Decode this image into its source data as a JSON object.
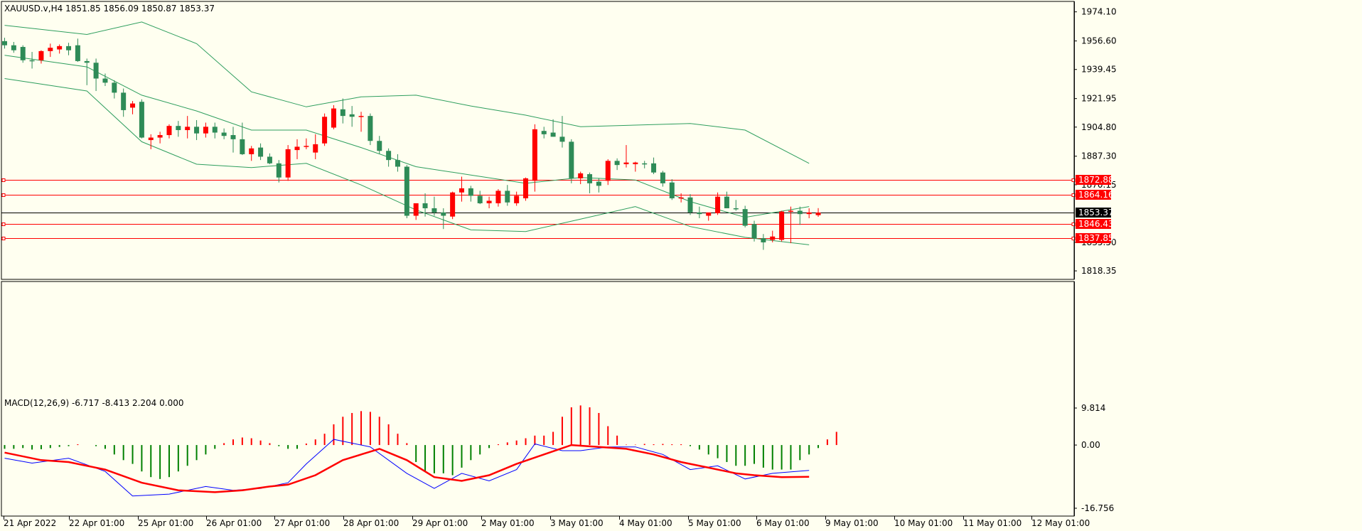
{
  "chart_data": [
    {
      "type": "candlestick",
      "title": "XAUUSD.v,H4  1851.85 1856.09 1850.87 1853.37",
      "symbol": "XAUUSD.v",
      "timeframe": "H4",
      "ohlc_last": {
        "open": 1851.85,
        "high": 1856.09,
        "low": 1850.87,
        "close": 1853.37
      },
      "ylim": [
        1811.0,
        1980.0
      ],
      "y_ticks": [
        "1974.10",
        "1956.60",
        "1939.45",
        "1921.95",
        "1904.80",
        "1887.30",
        "1870.15",
        "1835.50",
        "1818.35"
      ],
      "x_ticks": [
        "21 Apr 2022",
        "22 Apr 01:00",
        "25 Apr 01:00",
        "26 Apr 01:00",
        "27 Apr 01:00",
        "28 Apr 01:00",
        "29 Apr 01:00",
        "2 May 01:00",
        "3 May 01:00",
        "4 May 01:00",
        "5 May 01:00",
        "6 May 01:00",
        "9 May 01:00",
        "10 May 01:00",
        "11 May 01:00",
        "12 May 01:00"
      ],
      "candles": [
        [
          1956.5,
          1958.5,
          1952.0,
          1954.0
        ],
        [
          1954.0,
          1956.0,
          1949.5,
          1951.0
        ],
        [
          1953.0,
          1954.0,
          1943.5,
          1945.0
        ],
        [
          1945.0,
          1950.0,
          1940.0,
          1944.5
        ],
        [
          1945.0,
          1951.0,
          1943.0,
          1950.5
        ],
        [
          1950.5,
          1955.0,
          1947.0,
          1952.5
        ],
        [
          1951.5,
          1954.5,
          1949.0,
          1953.5
        ],
        [
          1953.5,
          1955.5,
          1948.0,
          1951.0
        ],
        [
          1954.0,
          1958.0,
          1944.0,
          1944.5
        ],
        [
          1944.5,
          1946.0,
          1930.0,
          1943.5
        ],
        [
          1943.5,
          1946.0,
          1926.5,
          1934.0
        ],
        [
          1934.0,
          1937.0,
          1929.5,
          1931.5
        ],
        [
          1931.5,
          1933.0,
          1922.0,
          1925.5
        ],
        [
          1925.5,
          1928.0,
          1911.0,
          1915.0
        ],
        [
          1916.5,
          1920.5,
          1912.5,
          1919.0
        ],
        [
          1920.0,
          1921.5,
          1898.0,
          1898.5
        ],
        [
          1897.0,
          1900.5,
          1891.5,
          1898.5
        ],
        [
          1898.5,
          1902.0,
          1895.0,
          1900.0
        ],
        [
          1900.0,
          1906.5,
          1898.0,
          1905.5
        ],
        [
          1905.5,
          1908.5,
          1899.0,
          1903.0
        ],
        [
          1903.0,
          1911.5,
          1898.0,
          1905.0
        ],
        [
          1905.0,
          1909.0,
          1897.0,
          1901.0
        ],
        [
          1901.0,
          1907.5,
          1898.5,
          1905.0
        ],
        [
          1905.0,
          1907.5,
          1898.0,
          1901.5
        ],
        [
          1901.5,
          1904.0,
          1897.5,
          1899.5
        ],
        [
          1900.0,
          1905.0,
          1889.5,
          1897.5
        ],
        [
          1897.5,
          1907.5,
          1888.0,
          1888.5
        ],
        [
          1888.5,
          1893.5,
          1884.5,
          1892.0
        ],
        [
          1892.5,
          1895.0,
          1885.0,
          1887.0
        ],
        [
          1887.0,
          1889.0,
          1882.5,
          1883.0
        ],
        [
          1883.0,
          1885.0,
          1871.5,
          1874.5
        ],
        [
          1874.5,
          1894.0,
          1872.5,
          1891.5
        ],
        [
          1891.0,
          1897.5,
          1885.5,
          1893.0
        ],
        [
          1893.0,
          1898.0,
          1891.5,
          1893.5
        ],
        [
          1889.5,
          1900.5,
          1885.5,
          1894.5
        ],
        [
          1895.0,
          1913.0,
          1893.5,
          1911.0
        ],
        [
          1904.5,
          1918.0,
          1903.5,
          1916.0
        ],
        [
          1915.5,
          1922.0,
          1907.0,
          1911.5
        ],
        [
          1912.5,
          1917.5,
          1905.0,
          1911.0
        ],
        [
          1911.5,
          1914.0,
          1902.0,
          1911.5
        ],
        [
          1911.5,
          1913.0,
          1894.0,
          1896.5
        ],
        [
          1896.5,
          1899.5,
          1888.5,
          1890.5
        ],
        [
          1890.5,
          1892.0,
          1881.0,
          1885.0
        ],
        [
          1885.0,
          1888.5,
          1878.0,
          1881.0
        ],
        [
          1881.0,
          1882.0,
          1850.0,
          1851.5
        ],
        [
          1851.5,
          1859.0,
          1849.0,
          1859.0
        ],
        [
          1859.0,
          1865.0,
          1851.0,
          1856.0
        ],
        [
          1856.0,
          1863.0,
          1851.5,
          1853.5
        ],
        [
          1853.5,
          1856.0,
          1843.5,
          1851.5
        ],
        [
          1851.0,
          1866.0,
          1849.5,
          1865.5
        ],
        [
          1865.5,
          1875.0,
          1860.0,
          1868.0
        ],
        [
          1868.0,
          1869.5,
          1860.0,
          1863.5
        ],
        [
          1863.5,
          1866.5,
          1858.5,
          1859.0
        ],
        [
          1859.0,
          1863.0,
          1856.0,
          1860.5
        ],
        [
          1859.0,
          1867.5,
          1857.0,
          1866.5
        ],
        [
          1866.5,
          1870.0,
          1857.5,
          1859.5
        ],
        [
          1859.0,
          1866.0,
          1857.5,
          1863.5
        ],
        [
          1862.0,
          1874.5,
          1860.5,
          1874.0
        ],
        [
          1872.5,
          1906.5,
          1866.0,
          1903.5
        ],
        [
          1902.5,
          1905.0,
          1898.0,
          1900.5
        ],
        [
          1901.5,
          1909.5,
          1899.0,
          1899.0
        ],
        [
          1899.0,
          1911.5,
          1892.5,
          1896.0
        ],
        [
          1896.0,
          1897.5,
          1871.0,
          1874.0
        ],
        [
          1874.0,
          1878.0,
          1870.5,
          1877.0
        ],
        [
          1876.5,
          1877.5,
          1865.0,
          1871.0
        ],
        [
          1872.0,
          1874.0,
          1865.5,
          1869.5
        ],
        [
          1872.5,
          1885.5,
          1870.0,
          1884.5
        ],
        [
          1884.5,
          1886.0,
          1879.0,
          1882.0
        ],
        [
          1882.5,
          1894.0,
          1880.5,
          1883.5
        ],
        [
          1882.5,
          1884.0,
          1878.0,
          1883.5
        ],
        [
          1883.0,
          1884.5,
          1880.0,
          1882.5
        ],
        [
          1883.0,
          1886.5,
          1876.5,
          1877.5
        ],
        [
          1877.5,
          1878.5,
          1869.0,
          1871.0
        ],
        [
          1871.5,
          1873.5,
          1861.0,
          1862.0
        ],
        [
          1862.0,
          1865.0,
          1859.5,
          1862.5
        ],
        [
          1862.5,
          1864.5,
          1852.0,
          1853.5
        ],
        [
          1853.5,
          1857.0,
          1850.0,
          1852.5
        ],
        [
          1851.5,
          1853.0,
          1848.5,
          1853.5
        ],
        [
          1853.0,
          1865.5,
          1852.0,
          1863.0
        ],
        [
          1863.0,
          1866.0,
          1856.0,
          1856.0
        ],
        [
          1856.0,
          1861.0,
          1854.5,
          1855.5
        ],
        [
          1855.5,
          1857.5,
          1844.5,
          1845.5
        ],
        [
          1846.5,
          1848.5,
          1836.0,
          1838.0
        ],
        [
          1838.0,
          1840.5,
          1831.0,
          1835.5
        ],
        [
          1837.0,
          1842.5,
          1835.5,
          1839.0
        ],
        [
          1837.0,
          1854.5,
          1836.0,
          1854.0
        ],
        [
          1854.0,
          1857.0,
          1835.0,
          1854.5
        ],
        [
          1854.5,
          1857.0,
          1846.0,
          1852.5
        ],
        [
          1852.5,
          1856.0,
          1850.0,
          1853.5
        ],
        [
          1851.85,
          1856.09,
          1850.87,
          1853.37
        ]
      ],
      "bollinger_bands": {
        "period": 20,
        "deviations": 2,
        "color": "#2e9e5e",
        "series": [
          {
            "x": [
              0,
              9,
              15,
              21,
              27,
              33,
              39,
              45,
              51,
              57,
              63,
              69,
              75,
              81,
              88
            ],
            "y": [
              1966.0,
              1960.5,
              1968.0,
              1955.0,
              1926.0,
              1917.0,
              1923.0,
              1924.0,
              1917.5,
              1912.0,
              1905.0,
              1906.0,
              1907.0,
              1903.0,
              1883.0
            ]
          },
          {
            "x": [
              0,
              9,
              15,
              21,
              27,
              33,
              39,
              45,
              51,
              57,
              63,
              69,
              75,
              81,
              88
            ],
            "y": [
              1948.0,
              1941.0,
              1924.0,
              1914.5,
              1903.0,
              1903.0,
              1892.5,
              1881.0,
              1876.0,
              1871.0,
              1874.5,
              1873.0,
              1860.0,
              1850.5,
              1857.0
            ]
          },
          {
            "x": [
              0,
              9,
              15,
              21,
              27,
              33,
              39,
              45,
              51,
              57,
              63,
              69,
              75,
              81,
              88
            ],
            "y": [
              1934.0,
              1926.5,
              1896.0,
              1882.5,
              1880.5,
              1883.0,
              1870.0,
              1855.0,
              1843.0,
              1842.0,
              1849.5,
              1857.0,
              1845.0,
              1838.5,
              1834.0
            ]
          }
        ]
      },
      "horizontal_levels": [
        {
          "value": 1872.88,
          "label": "1872.88",
          "color": "#ff0000"
        },
        {
          "value": 1864.16,
          "label": "1864.16",
          "color": "#ff0000"
        },
        {
          "value": 1853.37,
          "label": "1853.37",
          "color": "#000000"
        },
        {
          "value": 1846.43,
          "label": "1846.43",
          "color": "#ff0000"
        },
        {
          "value": 1837.85,
          "label": "1837.85",
          "color": "#ff0000"
        }
      ],
      "colors": {
        "bullish": "#ff0000",
        "bearish": "#2e8b57",
        "background": "#fffff0",
        "grid": false
      }
    },
    {
      "type": "bar",
      "title": "MACD(12,26,9) -6.717 -8.413 2.204 0.000",
      "ylim": [
        -16.756,
        9.814
      ],
      "y_ticks": [
        "9.814",
        "0.00",
        "-16.756"
      ],
      "histogram": [
        -1.0,
        -1.0,
        -0.8,
        -1.2,
        -1.1,
        -0.8,
        -0.5,
        -0.3,
        0.2,
        0.0,
        -0.3,
        -1.0,
        -2.5,
        -4.0,
        -5.0,
        -7.0,
        -8.5,
        -9.0,
        -8.5,
        -7.0,
        -5.5,
        -4.0,
        -2.5,
        -1.0,
        0.5,
        1.5,
        2.0,
        1.8,
        1.2,
        0.5,
        -0.3,
        -1.0,
        -1.0,
        0.4,
        1.5,
        3.0,
        5.5,
        7.5,
        8.5,
        9.0,
        8.8,
        7.5,
        5.5,
        3.0,
        0.5,
        -4.5,
        -7.0,
        -7.5,
        -7.5,
        -8.0,
        -6.0,
        -4.0,
        -2.5,
        -0.8,
        0.2,
        0.7,
        1.2,
        1.8,
        2.5,
        2.5,
        3.5,
        7.5,
        10.0,
        10.5,
        10.0,
        8.5,
        5.0,
        2.5,
        0.1,
        0.1,
        0.3,
        0.2,
        0.3,
        0.2,
        0.2,
        -0.3,
        -1.2,
        -2.5,
        -3.5,
        -4.5,
        -5.5,
        -5.5,
        -5.0,
        -6.0,
        -6.5,
        -6.5,
        -6.5,
        -4.0,
        -2.5,
        -0.8,
        1.5,
        3.5
      ],
      "series": [
        {
          "name": "MACD",
          "color": "#0000ff",
          "x": [
            0,
            3,
            7,
            11,
            14,
            18,
            22,
            25,
            28,
            31,
            33,
            36,
            40,
            44,
            47,
            50,
            53,
            56,
            58,
            61,
            63,
            66,
            69,
            72,
            75,
            78,
            81,
            84,
            88
          ],
          "y": [
            -3.5,
            -4.8,
            -3.5,
            -7.0,
            -13.5,
            -13.0,
            -11.0,
            -12.0,
            -11.5,
            -10.0,
            -5.0,
            1.5,
            -0.5,
            -7.5,
            -11.5,
            -7.5,
            -9.5,
            -6.5,
            0.3,
            -1.5,
            -1.5,
            -0.5,
            -0.5,
            -2.5,
            -6.5,
            -5.5,
            -9.0,
            -7.5,
            -6.717
          ]
        },
        {
          "name": "Signal",
          "color": "#ff0000",
          "x": [
            0,
            4,
            7,
            11,
            15,
            19,
            23,
            26,
            29,
            31,
            34,
            37,
            41,
            44,
            47,
            50,
            53,
            56,
            59,
            62,
            65,
            68,
            71,
            74,
            77,
            80,
            82,
            85,
            88
          ],
          "y": [
            -2.0,
            -4.0,
            -4.5,
            -6.5,
            -10.0,
            -12.0,
            -12.5,
            -12.0,
            -11.0,
            -10.5,
            -8.0,
            -4.0,
            -1.0,
            -4.0,
            -8.5,
            -9.5,
            -8.0,
            -5.0,
            -2.5,
            0.0,
            -0.5,
            -1.0,
            -2.5,
            -4.5,
            -6.0,
            -7.5,
            -8.0,
            -8.5,
            -8.413
          ]
        }
      ],
      "colors": {
        "histogram_up": "#ff0000",
        "histogram_down": "#008000",
        "background": "#fffff0"
      }
    }
  ]
}
